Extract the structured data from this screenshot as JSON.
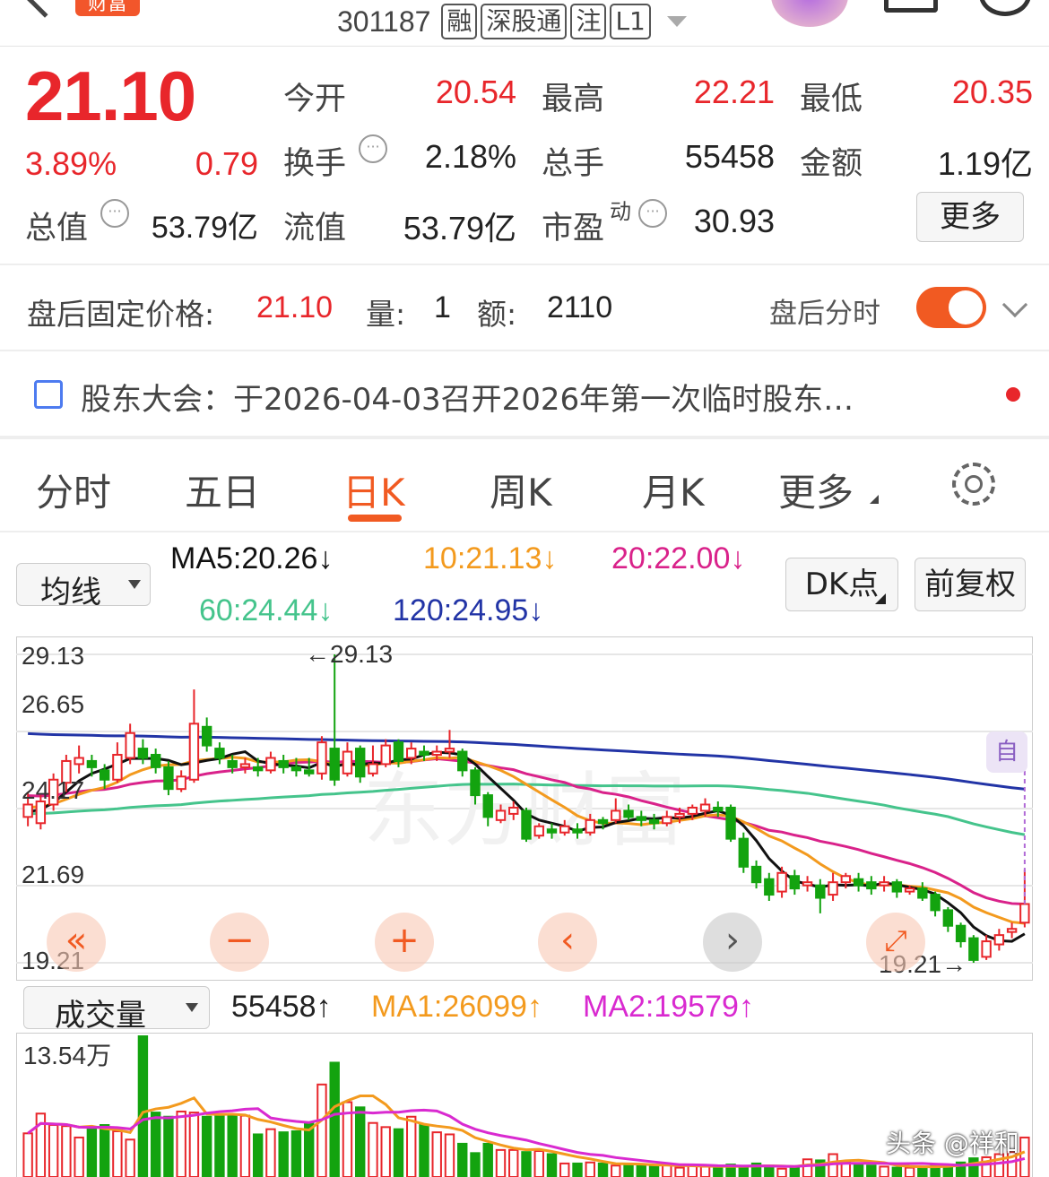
{
  "header": {
    "stock_code": "301187",
    "tags": [
      "融",
      "深股通",
      "注",
      "L1"
    ],
    "logo_text": "财富"
  },
  "quote": {
    "price": "21.10",
    "change_pct": "3.89%",
    "change_amt": "0.79",
    "open_label": "今开",
    "open": "20.54",
    "high_label": "最高",
    "high": "22.21",
    "low_label": "最低",
    "low": "20.35",
    "turnover_label": "换手",
    "turnover": "2.18%",
    "volume_label": "总手",
    "volume": "55458",
    "amount_label": "金额",
    "amount": "1.19亿",
    "total_cap_label": "总值",
    "total_cap": "53.79亿",
    "float_cap_label": "流值",
    "float_cap": "53.79亿",
    "pe_label": "市盈",
    "pe_sup": "动",
    "pe": "30.93",
    "more_label": "更多"
  },
  "after_hours": {
    "label": "盘后固定价格:",
    "price": "21.10",
    "vol_label": "量:",
    "vol": "1",
    "amt_label": "额:",
    "amt": "2110",
    "toggle_label": "盘后分时",
    "toggle_on": true
  },
  "notice": {
    "text": "股东大会：于2026-04-03召开2026年第一次临时股东…"
  },
  "tabs": [
    {
      "label": "分时"
    },
    {
      "label": "五日"
    },
    {
      "label": "日K",
      "active": true
    },
    {
      "label": "周K"
    },
    {
      "label": "月K"
    },
    {
      "label": "更多"
    }
  ],
  "ma_row": {
    "dropdown": "均线",
    "ma5": "MA5:20.26↓",
    "ma10": "10:21.13↓",
    "ma20": "20:22.00↓",
    "ma60": "60:24.44↓",
    "ma120": "120:24.95↓",
    "dk_button": "DK点",
    "adjust_button": "前复权"
  },
  "colors": {
    "up": "#e8262b",
    "down": "#13a30f",
    "ma5": "#111111",
    "ma10": "#f39a1e",
    "ma20": "#d9228a",
    "ma60": "#45c48c",
    "ma120": "#2234a6",
    "accent": "#f15a22"
  },
  "kline": {
    "y_labels": [
      "29.13",
      "26.65",
      "24.17",
      "21.69",
      "19.21"
    ],
    "max_label": "←29.13",
    "min_label": "19.21→",
    "auto_label": "自",
    "watermark": "东方财富"
  },
  "volume": {
    "dropdown": "成交量",
    "value": "55458↑",
    "ma1": "MA1:26099↑",
    "ma2": "MA2:19579↑",
    "y_label": "13.54万"
  },
  "watermark": "头条 @祥和",
  "chart_data": {
    "type": "candlestick",
    "ylim": [
      19.21,
      29.13
    ],
    "candles": [
      [
        23.9,
        24.3,
        24.7,
        23.6
      ],
      [
        23.7,
        24.4,
        24.6,
        23.5
      ],
      [
        24.3,
        25.1,
        25.3,
        24.1
      ],
      [
        25.0,
        25.7,
        25.9,
        24.7
      ],
      [
        25.6,
        25.8,
        26.2,
        25.3
      ],
      [
        25.7,
        25.5,
        25.9,
        25.2
      ],
      [
        25.4,
        25.1,
        25.6,
        24.8
      ],
      [
        25.1,
        25.9,
        26.3,
        25.0
      ],
      [
        25.8,
        26.6,
        26.9,
        25.6
      ],
      [
        26.1,
        25.8,
        26.4,
        25.6
      ],
      [
        25.9,
        25.5,
        26.1,
        25.3
      ],
      [
        25.5,
        24.8,
        25.7,
        24.6
      ],
      [
        24.8,
        25.2,
        25.4,
        24.7
      ],
      [
        25.1,
        26.9,
        28.0,
        25.0
      ],
      [
        26.8,
        26.2,
        27.1,
        26.0
      ],
      [
        26.1,
        25.8,
        26.3,
        25.6
      ],
      [
        25.7,
        25.5,
        25.9,
        25.3
      ],
      [
        25.5,
        25.6,
        25.8,
        25.3
      ],
      [
        25.5,
        25.4,
        25.8,
        25.2
      ],
      [
        25.4,
        25.8,
        26.0,
        25.3
      ],
      [
        25.7,
        25.5,
        25.9,
        25.3
      ],
      [
        25.5,
        25.4,
        25.8,
        25.2
      ],
      [
        25.4,
        25.3,
        25.8,
        25.2
      ],
      [
        25.3,
        26.3,
        26.5,
        25.1
      ],
      [
        26.1,
        25.1,
        29.13,
        24.9
      ],
      [
        25.3,
        26.0,
        26.3,
        25.2
      ],
      [
        26.1,
        25.2,
        26.2,
        25.0
      ],
      [
        25.3,
        25.6,
        26.2,
        25.2
      ],
      [
        25.6,
        26.2,
        26.4,
        25.5
      ],
      [
        26.3,
        25.7,
        26.4,
        25.5
      ],
      [
        25.8,
        26.1,
        26.3,
        25.6
      ],
      [
        26.0,
        25.9,
        26.2,
        25.7
      ],
      [
        25.9,
        26.0,
        26.2,
        25.7
      ],
      [
        26.0,
        26.1,
        26.7,
        25.8
      ],
      [
        26.0,
        25.4,
        26.1,
        25.2
      ],
      [
        25.4,
        24.6,
        25.5,
        24.3
      ],
      [
        24.6,
        23.9,
        24.7,
        23.6
      ],
      [
        23.8,
        24.1,
        24.3,
        23.7
      ],
      [
        24.0,
        24.2,
        24.4,
        23.8
      ],
      [
        24.1,
        23.2,
        24.2,
        23.1
      ],
      [
        23.3,
        23.6,
        23.7,
        23.2
      ],
      [
        23.5,
        23.4,
        23.7,
        23.2
      ],
      [
        23.4,
        23.6,
        23.8,
        23.3
      ],
      [
        23.5,
        23.4,
        23.7,
        23.2
      ],
      [
        23.4,
        23.8,
        24.0,
        23.3
      ],
      [
        23.8,
        23.7,
        23.9,
        23.5
      ],
      [
        23.8,
        24.1,
        24.5,
        23.7
      ],
      [
        24.1,
        23.9,
        24.3,
        23.8
      ],
      [
        23.9,
        23.8,
        24.1,
        23.6
      ],
      [
        23.8,
        23.7,
        24.0,
        23.5
      ],
      [
        23.7,
        23.9,
        24.1,
        23.6
      ],
      [
        23.9,
        24.0,
        24.2,
        23.7
      ],
      [
        24.0,
        24.2,
        24.3,
        23.8
      ],
      [
        24.1,
        24.3,
        24.5,
        23.9
      ],
      [
        24.2,
        24.1,
        24.4,
        23.9
      ],
      [
        24.2,
        23.2,
        24.3,
        23.1
      ],
      [
        23.2,
        22.3,
        23.4,
        22.1
      ],
      [
        22.3,
        21.8,
        22.5,
        21.6
      ],
      [
        21.9,
        21.4,
        22.1,
        21.2
      ],
      [
        21.5,
        22.1,
        22.3,
        21.3
      ],
      [
        22.0,
        21.6,
        22.2,
        21.4
      ],
      [
        21.7,
        21.8,
        22.0,
        21.5
      ],
      [
        21.7,
        21.3,
        21.9,
        20.8
      ],
      [
        21.4,
        21.8,
        22.1,
        21.2
      ],
      [
        21.8,
        22.0,
        22.1,
        21.6
      ],
      [
        21.9,
        21.7,
        22.1,
        21.5
      ],
      [
        21.8,
        21.6,
        22.0,
        21.4
      ],
      [
        21.7,
        21.8,
        22.0,
        21.5
      ],
      [
        21.8,
        21.5,
        21.9,
        21.3
      ],
      [
        21.5,
        21.6,
        21.7,
        21.4
      ],
      [
        21.6,
        21.3,
        21.8,
        21.2
      ],
      [
        21.4,
        20.9,
        21.5,
        20.7
      ],
      [
        20.9,
        20.4,
        21.0,
        20.2
      ],
      [
        20.4,
        19.9,
        20.5,
        19.7
      ],
      [
        20.0,
        19.3,
        20.1,
        19.21
      ],
      [
        19.4,
        19.9,
        20.1,
        19.3
      ],
      [
        19.8,
        20.1,
        20.3,
        19.6
      ],
      [
        20.2,
        20.3,
        20.5,
        20.0
      ],
      [
        20.5,
        21.1,
        22.21,
        20.35
      ]
    ],
    "volumes": [
      4.2,
      6.1,
      5.0,
      4.9,
      3.8,
      4.6,
      5.0,
      4.4,
      3.6,
      13.54,
      6.2,
      5.8,
      6.3,
      6.2,
      5.8,
      6.0,
      5.9,
      5.9,
      4.1,
      4.6,
      4.3,
      4.4,
      5.2,
      8.9,
      11.0,
      7.2,
      6.7,
      5.2,
      4.8,
      4.6,
      5.8,
      5.0,
      4.3,
      4.1,
      3.2,
      2.3,
      3.2,
      2.6,
      2.6,
      2.4,
      2.5,
      2.2,
      1.3,
      1.3,
      1.4,
      1.3,
      1.1,
      1.2,
      1.2,
      1.0,
      1.2,
      0.9,
      1.1,
      1.0,
      0.9,
      1.2,
      0.9,
      1.3,
      1.1,
      0.8,
      0.9,
      1.7,
      1.6,
      2.2,
      1.4,
      1.2,
      1.1,
      1.0,
      0.9,
      0.9,
      1.0,
      1.1,
      1.2,
      1.4,
      1.8,
      1.9,
      2.2,
      2.4,
      3.8
    ]
  }
}
